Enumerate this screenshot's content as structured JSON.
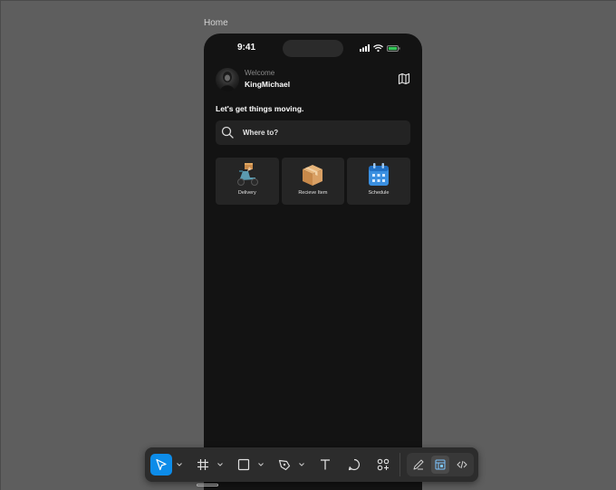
{
  "canvas": {
    "frame_label": "Home"
  },
  "status_bar": {
    "time": "9:41"
  },
  "header": {
    "welcome": "Welcome",
    "username": "KingMichael"
  },
  "tagline": "Let's get things moving.",
  "search": {
    "placeholder": "Where to?"
  },
  "services": [
    {
      "label": "Delivery",
      "icon": "scooter-icon"
    },
    {
      "label": "Recieve Item",
      "icon": "package-icon"
    },
    {
      "label": "Schedule",
      "icon": "calendar-icon"
    }
  ],
  "toolbar": {
    "tools": [
      "move-tool",
      "frame-tool",
      "shape-tool",
      "pen-tool",
      "text-tool",
      "comment-tool",
      "components-tool"
    ],
    "modes": [
      "draw-mode",
      "design-mode",
      "dev-mode"
    ],
    "active_tool": "move-tool",
    "active_mode": "design-mode"
  },
  "colors": {
    "canvas_bg": "#5e5e5e",
    "phone_bg": "#131313",
    "card_bg": "#252525",
    "accent": "#0d8ce9",
    "battery": "#35c759"
  }
}
